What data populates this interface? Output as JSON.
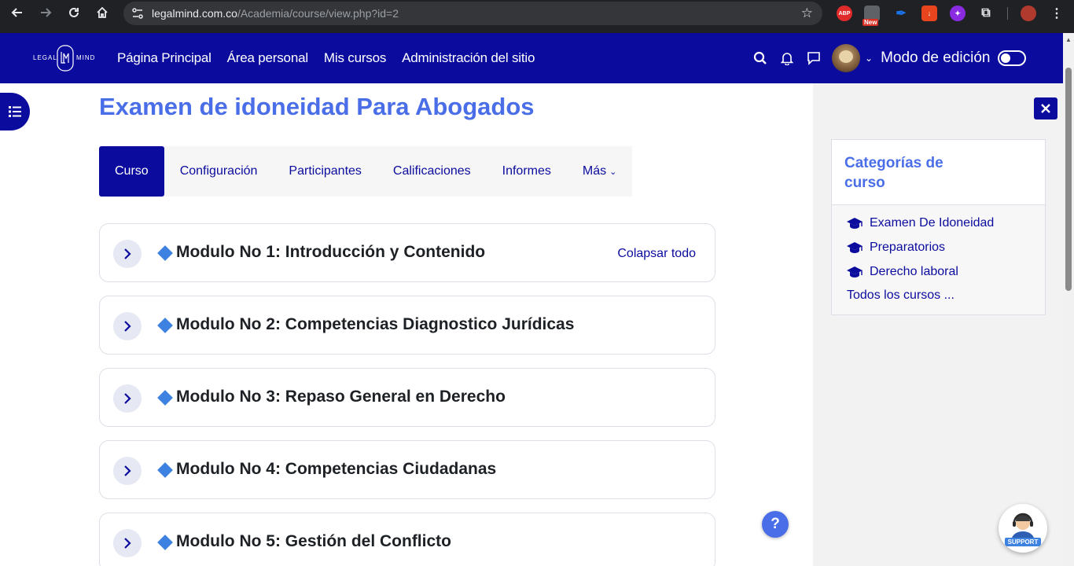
{
  "browser": {
    "url_host": "legalmind.com.co",
    "url_path": "/Academia/course/view.php?id=2",
    "extensions": [
      {
        "name": "adblock-extension-icon",
        "label": "ABP",
        "color": "#e02b2b"
      },
      {
        "name": "news-extension-icon",
        "label": "New",
        "color": "#d93025"
      },
      {
        "name": "pen-extension-icon",
        "label": "",
        "color": "#1a73e8"
      },
      {
        "name": "download-extension-icon",
        "label": "",
        "color": "#e8441d"
      },
      {
        "name": "pinwheel-extension-icon",
        "label": "",
        "color": "#8a2be2"
      }
    ]
  },
  "navbar": {
    "logo_text_left": "LEGAL",
    "logo_text_right": "MIND",
    "logo_monogram": "LM",
    "links": [
      "Página Principal",
      "Área personal",
      "Mis cursos",
      "Administración del sitio"
    ],
    "edit_mode_label": "Modo de edición",
    "edit_mode_on": false
  },
  "course": {
    "title": "Examen de idoneidad Para Abogados",
    "tabs": [
      {
        "label": "Curso",
        "active": true
      },
      {
        "label": "Configuración",
        "active": false
      },
      {
        "label": "Participantes",
        "active": false
      },
      {
        "label": "Calificaciones",
        "active": false
      },
      {
        "label": "Informes",
        "active": false
      },
      {
        "label": "Más",
        "active": false
      }
    ],
    "collapse_all_label": "Colapsar todo",
    "modules": [
      "Modulo No 1: Introducción y Contenido",
      "Modulo No 2: Competencias Diagnostico Jurídicas",
      "Modulo No 3: Repaso General en Derecho",
      "Modulo No 4: Competencias Ciudadanas",
      "Modulo No 5: Gestión del Conflicto"
    ]
  },
  "sidebar": {
    "block_title": "Categorías de curso",
    "categories": [
      "Examen De Idoneidad",
      "Preparatorios",
      "Derecho laboral"
    ],
    "all_courses_label": "Todos los cursos ..."
  },
  "floating": {
    "help_label": "?",
    "support_label": "SUPPORT"
  },
  "colors": {
    "brand_navy": "#0b0b9e",
    "title_blue": "#4a6ee8",
    "diamond_blue": "#3d82e0"
  }
}
